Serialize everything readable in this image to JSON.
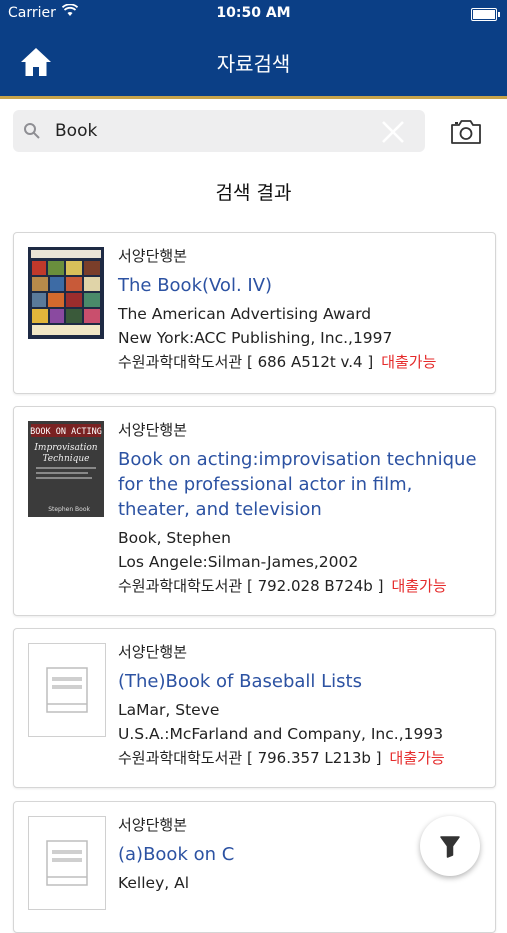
{
  "status": {
    "carrier": "Carrier",
    "time": "10:50 AM"
  },
  "nav": {
    "title": "자료검색"
  },
  "search": {
    "query": "Book"
  },
  "results": {
    "heading": "검색 결과"
  },
  "items": [
    {
      "type": "서양단행본",
      "title": "The Book(Vol. IV)",
      "author": "The American Advertising Award",
      "publisher": "New York:ACC Publishing, Inc.,1997",
      "location": "수원과학대학도서관 [ 686 A512t v.4 ]",
      "availability": "대출가능"
    },
    {
      "type": "서양단행본",
      "title": "Book on acting:improvisation technique for the professional actor in film, theater, and television",
      "author": "Book, Stephen",
      "publisher": "Los Angele:Silman-James,2002",
      "location": "수원과학대학도서관 [ 792.028 B724b ]",
      "availability": "대출가능",
      "cover_text": {
        "line1": "BOOK ON ACTING",
        "line2": "Improvisation",
        "line3": "Technique",
        "author": "Stephen Book"
      }
    },
    {
      "type": "서양단행본",
      "title": "(The)Book of Baseball Lists",
      "author": "LaMar, Steve",
      "publisher": "U.S.A.:McFarland and Company, Inc.,1993",
      "location": "수원과학대학도서관 [ 796.357 L213b ]",
      "availability": "대출가능"
    },
    {
      "type": "서양단행본",
      "title": "(a)Book on C",
      "author": "Kelley, Al"
    }
  ],
  "colors": {
    "navbar": "#0b3f86",
    "accent_line": "#c8a44b",
    "title_link": "#2c52a2",
    "available": "#e52b2b"
  },
  "icons": {
    "home": "home-icon",
    "search": "search-icon",
    "clear": "close-icon",
    "camera": "camera-icon",
    "filter": "funnel-icon"
  }
}
